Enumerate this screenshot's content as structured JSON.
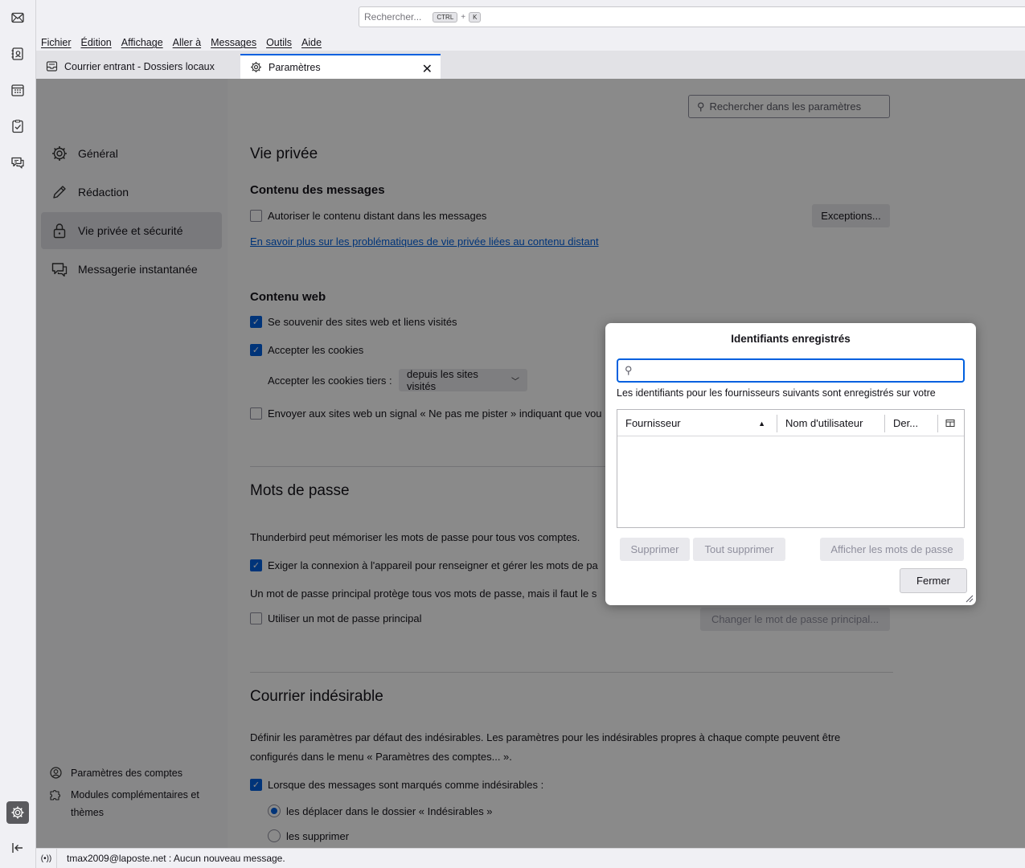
{
  "spaces": {
    "items": [
      "mail-icon",
      "address-book-icon",
      "calendar-icon",
      "tasks-icon",
      "chat-icon"
    ],
    "settings": "gear-icon",
    "collapse": "collapse-icon"
  },
  "topbar": {
    "search_placeholder": "Rechercher...",
    "shortcut_ctrl": "CTRL",
    "shortcut_plus": "+",
    "shortcut_key": "K"
  },
  "menubar": {
    "items": [
      "Fichier",
      "Édition",
      "Affichage",
      "Aller à",
      "Messages",
      "Outils",
      "Aide"
    ]
  },
  "tabs": {
    "inbox": "Courrier entrant - Dossiers locaux",
    "settings": "Paramètres",
    "close": "✕"
  },
  "nav": {
    "categories": [
      "Général",
      "Rédaction",
      "Vie privée et sécurité",
      "Messagerie instantanée"
    ],
    "footer": [
      "Paramètres des comptes",
      "Modules complémentaires et",
      "thèmes"
    ]
  },
  "settings": {
    "search_placeholder": "Rechercher dans les paramètres",
    "privacy_title": "Vie privée",
    "message_content_title": "Contenu des messages",
    "remote_content": "Autoriser le contenu distant dans les messages",
    "exceptions_button": "Exceptions...",
    "learn_more": "En savoir plus sur les problématiques de vie privée liées au contenu distant",
    "web_content_title": "Contenu web",
    "remember_sites": "Se souvenir des sites web et liens visités",
    "accept_cookies": "Accepter les cookies",
    "third_party_label": "Accepter les cookies tiers :",
    "third_party_value": "depuis les sites visités",
    "dnt": "Envoyer aux sites web un signal « Ne pas me pister » indiquant que vou",
    "passwords_title": "Mots de passe",
    "passwords_desc": "Thunderbird peut mémoriser les mots de passe pour tous vos comptes.",
    "require_device_login": "Exiger la connexion à l'appareil pour renseigner et gérer les mots de pa",
    "primary_pw_desc": "Un mot de passe principal protège tous vos mots de passe, mais il faut le s",
    "use_primary_pw": "Utiliser un mot de passe principal",
    "change_primary_pw": "Changer le mot de passe principal...",
    "junk_title": "Courrier indésirable",
    "junk_desc_1": "Définir les paramètres par défaut des indésirables. Les paramètres pour les indésirables propres à chaque compte peuvent être",
    "junk_desc_2": "configurés dans le menu « Paramètres des comptes... ».",
    "junk_when_marked": "Lorsque des messages sont marqués comme indésirables :",
    "junk_move": "les déplacer dans le dossier « Indésirables »",
    "junk_delete": "les supprimer"
  },
  "status": {
    "icon": "(•))",
    "text": "tmax2009@laposte.net : Aucun nouveau message."
  },
  "dialog": {
    "title": "Identifiants enregistrés",
    "search_value": "",
    "description": "Les identifiants pour les fournisseurs suivants sont enregistrés sur votre",
    "columns": [
      "Fournisseur",
      "Nom d'utilisateur",
      "Der..."
    ],
    "rows": [],
    "remove": "Supprimer",
    "remove_all": "Tout supprimer",
    "show_passwords": "Afficher les mots de passe",
    "close": "Fermer"
  },
  "colors": {
    "accent": "#0060df",
    "overlay": "rgba(0,0,0,0.46)"
  }
}
